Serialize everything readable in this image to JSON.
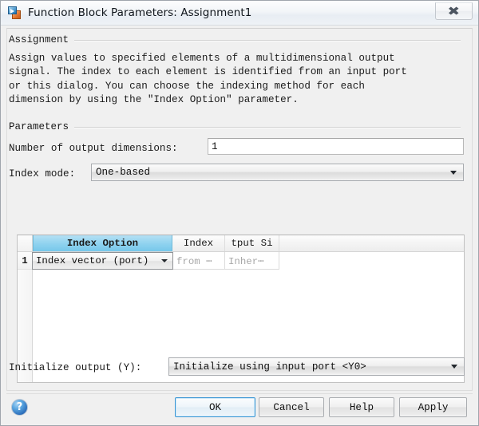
{
  "window": {
    "title": "Function Block Parameters: Assignment1",
    "icon": "simulink-block-icon",
    "close_label": "✕"
  },
  "groups": {
    "description_title": "Assignment",
    "parameters_title": "Parameters"
  },
  "description": {
    "text": "Assign values to specified elements of a multidimensional output\nsignal. The index to each element is identified from an input port\nor this dialog. You can choose the indexing method for each\ndimension by using the \"Index Option\" parameter."
  },
  "parameters": {
    "num_dims_label": "Number of output dimensions:",
    "num_dims_value": "1",
    "index_mode_label": "Index mode:",
    "index_mode_value": "One-based"
  },
  "table": {
    "columns": [
      "",
      "Index Option",
      "Index",
      "tput Si",
      ""
    ],
    "selected_column": "Index Option",
    "rows": [
      {
        "number": "1",
        "index_option": "Index vector (port)",
        "index": "from ⋯",
        "output_size": "Inher⋯"
      }
    ]
  },
  "initialize": {
    "label": "Initialize output (Y):",
    "value": "Initialize using input port <Y0>"
  },
  "buttons": {
    "help_icon": "help-question-icon",
    "ok": "OK",
    "cancel": "Cancel",
    "help": "Help",
    "apply": "Apply"
  },
  "colors": {
    "selected_header": "#8ed2ef",
    "focus_border": "#3a96d4",
    "window_bg": "#f0f0f0",
    "disabled_text": "#a8a8a8"
  }
}
